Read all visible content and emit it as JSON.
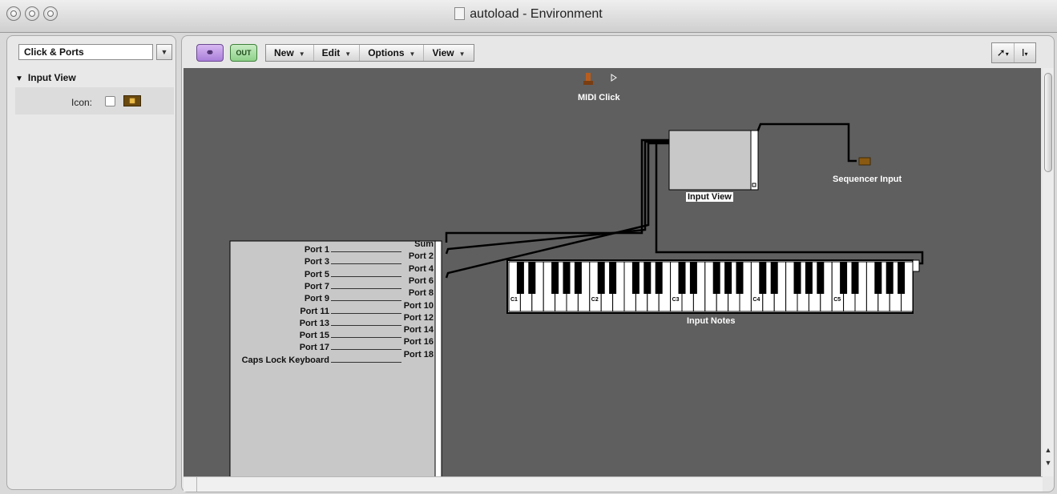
{
  "window": {
    "title": "autoload - Environment"
  },
  "colors": {
    "canvas": "#5f5f5f",
    "object_fill": "#c8c8c8",
    "cable": "#000000",
    "link_button": "#b38be0",
    "out_button": "#9ad494"
  },
  "sidebar": {
    "layer_select": "Click & Ports",
    "section_title": "Input View",
    "icon_label": "Icon:"
  },
  "toolbar": {
    "link_icon": "link-icon",
    "out_label": "OUT",
    "menus": [
      "New",
      "Edit",
      "Options",
      "View"
    ],
    "tool_icons": [
      "pointer-tool-icon",
      "text-cursor-tool-icon"
    ]
  },
  "environment": {
    "midi_click": {
      "label": "MIDI Click"
    },
    "sequencer_input": {
      "label": "Sequencer Input"
    },
    "input_view": {
      "label": "Input View"
    },
    "keyboard": {
      "label": "Input Notes",
      "octave_labels": [
        "C1",
        "C2",
        "C3",
        "C4",
        "C5"
      ]
    },
    "ports": {
      "left_labels": [
        "Port 1",
        "Port 3",
        "Port 5",
        "Port 7",
        "Port 9",
        "Port 11",
        "Port 13",
        "Port 15",
        "Port 17",
        "Caps Lock Keyboard"
      ],
      "right_labels": [
        "Sum",
        "Port 2",
        "Port 4",
        "Port 6",
        "Port 8",
        "Port 10",
        "Port 12",
        "Port 14",
        "Port 16",
        "Port 18"
      ]
    }
  }
}
